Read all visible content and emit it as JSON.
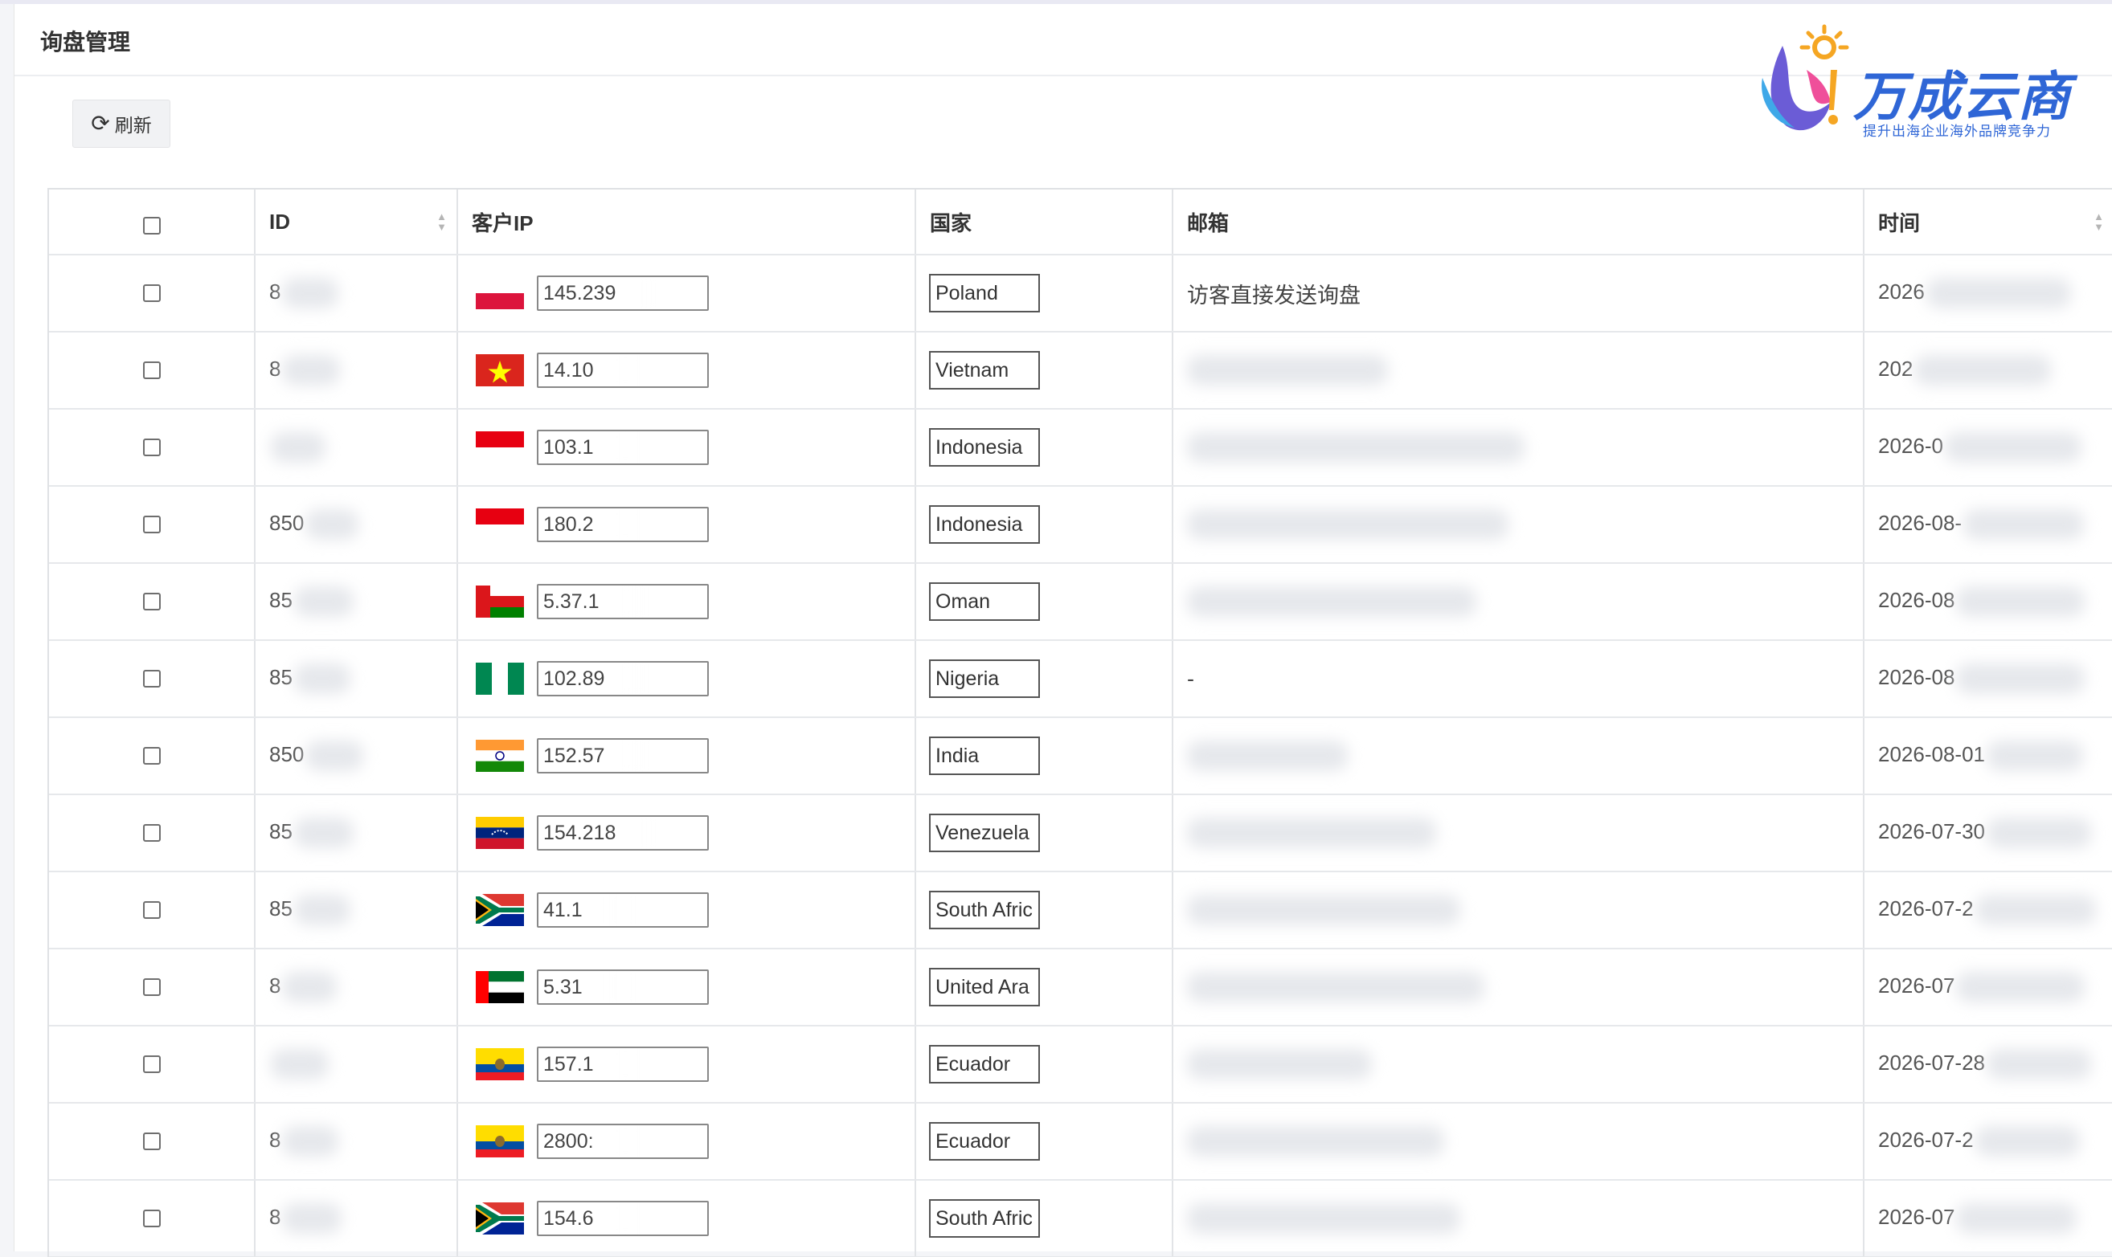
{
  "page": {
    "title": "询盘管理"
  },
  "logo": {
    "name": "万成云商",
    "slogan": "提升出海企业海外品牌竞争力"
  },
  "toolbar": {
    "refresh_label": "刷新",
    "refresh_icon": "refresh-icon"
  },
  "table": {
    "columns": [
      {
        "key": "select",
        "label": ""
      },
      {
        "key": "id",
        "label": "ID",
        "sortable": true
      },
      {
        "key": "ip",
        "label": "客户IP"
      },
      {
        "key": "country",
        "label": "国家"
      },
      {
        "key": "email",
        "label": "邮箱"
      },
      {
        "key": "time",
        "label": "时间",
        "sortable": true
      }
    ],
    "rows": [
      {
        "id": "8",
        "ip": "145.239",
        "flag": "poland",
        "country": "Poland",
        "email": "访客直接发送询盘",
        "time": "2026"
      },
      {
        "id": "8",
        "ip": "14.10",
        "flag": "vietnam",
        "country": "Vietnam",
        "email": "",
        "time": "202"
      },
      {
        "id": "",
        "ip": "103.1",
        "flag": "indonesia",
        "country": "Indonesia",
        "email": "",
        "time": "2026-0"
      },
      {
        "id": "850",
        "ip": "180.2",
        "flag": "indonesia",
        "country": "Indonesia",
        "email": "",
        "time": "2026-08-"
      },
      {
        "id": "85",
        "ip": "5.37.1",
        "flag": "oman",
        "country": "Oman",
        "email": "",
        "time": "2026-08"
      },
      {
        "id": "85",
        "ip": "102.89",
        "flag": "nigeria",
        "country": "Nigeria",
        "email": "-",
        "time": "2026-08"
      },
      {
        "id": "850",
        "ip": "152.57",
        "flag": "india",
        "country": "India",
        "email": "",
        "time": "2026-08-01"
      },
      {
        "id": "85",
        "ip": "154.218",
        "flag": "venezuela",
        "country": "Venezuela",
        "email": "",
        "time": "2026-07-30"
      },
      {
        "id": "85",
        "ip": "41.1",
        "flag": "south-africa",
        "country": "South Afric",
        "email": "",
        "time": "2026-07-2"
      },
      {
        "id": "8",
        "ip": "5.31",
        "flag": "uae",
        "country": "United Ara",
        "email": "",
        "time": "2026-07"
      },
      {
        "id": "",
        "ip": "157.1",
        "flag": "ecuador",
        "country": "Ecuador",
        "email": "",
        "time": "2026-07-28"
      },
      {
        "id": "8",
        "ip": "2800:",
        "flag": "ecuador",
        "country": "Ecuador",
        "email": "",
        "time": "2026-07-2"
      },
      {
        "id": "8",
        "ip": "154.6",
        "flag": "south-africa",
        "country": "South Afric",
        "email": "",
        "time": "2026-07"
      }
    ]
  },
  "colors": {
    "logo_blue": "#2f66d6",
    "border": "#e2e4e7",
    "header_bg": "#ffffff"
  }
}
